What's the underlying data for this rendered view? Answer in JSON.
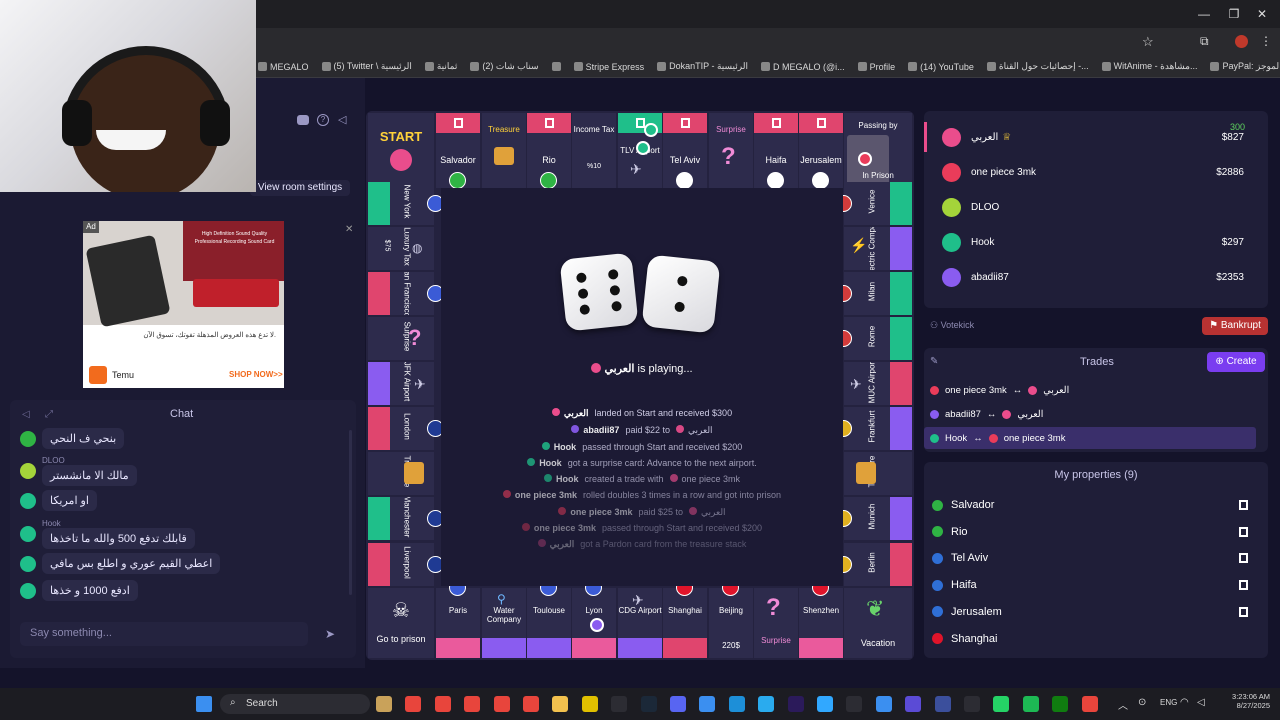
{
  "browser": {
    "bookmarks": [
      "MEGALO",
      "(5) Twitter \\ الرئيسية",
      "ثمانية",
      "(2) سناب شات",
      "",
      "Stripe Express",
      "DokanTIP - الرئيسية",
      "D MEGALO (@i...",
      "Profile",
      "(14) YouTube",
      "إحصائيات حول القناة -...",
      "WitAnime - مشاهدة...",
      "PayPal: الموجز"
    ]
  },
  "left": {
    "room_settings": "View room settings",
    "ad": {
      "badge": "Ad",
      "headline1": "High Definition Sound Quality",
      "headline2": "Professional Recording Sound Card",
      "text": "لا تدع هذه العروض المذهلة تفوتك، تسوق الآن.",
      "brand": "Temu",
      "cta": "SHOP NOW>>"
    },
    "chat": {
      "title": "Chat",
      "messages": [
        {
          "nick": "",
          "text": "بنحي ف النحي"
        },
        {
          "nick": "DLOO",
          "text": "مالك الا مانشستر"
        },
        {
          "nick": "",
          "text": "او امريكا"
        },
        {
          "nick": "Hook",
          "text": "قابلك تدفع 500 والله ما تاخذها"
        },
        {
          "nick": "",
          "text": "اعطي القيم عوري و اطلع بس مافي"
        },
        {
          "nick": "",
          "text": "ادفع 1000 و خذها"
        }
      ],
      "placeholder": "Say something..."
    }
  },
  "board": {
    "top": {
      "start": "START",
      "treasure": "Treasure",
      "income_tax": "Income Tax",
      "income_tax_pct": "%10",
      "surprise": "Surprise",
      "passing_by": "Passing by",
      "in_prison": "In Prison",
      "cities": [
        "Salvador",
        "Rio",
        "TLV Airport",
        "Tel Aviv",
        "Haifa",
        "Jerusalem"
      ]
    },
    "left": [
      "New York",
      "Luxury Tax",
      "$75",
      "San Francisco",
      "Surprise",
      "JFK Airport",
      "London",
      "Treasure",
      "Manchester",
      "Liverpool"
    ],
    "right": [
      "Venice",
      "Electric Company",
      "Milan",
      "Rome",
      "MUC Airport",
      "Frankfurt",
      "Treasure",
      "Munich",
      "Berlin"
    ],
    "bottom": {
      "go_to_prison": "Go to prison",
      "vacation": "Vacation",
      "surprise": "Surprise",
      "price": "220$",
      "cities": [
        "Paris",
        "Water Company",
        "Toulouse",
        "Lyon",
        "CDG Airport",
        "Shanghai",
        "Beijing",
        "Shenzhen"
      ]
    },
    "status": {
      "player": "العربي",
      "text": "is playing..."
    },
    "log": [
      {
        "a": "العربي",
        "t": "landed on Start and received $300"
      },
      {
        "a": "abadii87",
        "t": "paid $22 to",
        "b": "العربي"
      },
      {
        "a": "Hook",
        "t": "passed through Start and received $200"
      },
      {
        "a": "Hook",
        "t": "got a surprise card: Advance to the next airport."
      },
      {
        "a": "Hook",
        "t": "created a trade with",
        "b": "one piece 3mk"
      },
      {
        "a": "one piece 3mk",
        "t": "rolled doubles 3 times in a row and got into prison"
      },
      {
        "a": "one piece 3mk",
        "t": "paid $25 to",
        "b": "العربي"
      },
      {
        "a": "one piece 3mk",
        "t": "passed through Start and received $200"
      },
      {
        "a": "العربي",
        "t": "got a Pardon card from the treasure stack"
      }
    ]
  },
  "players": [
    {
      "name": "العربي",
      "crown": "♕",
      "money": "$827",
      "bonus": "300",
      "color": "#ea4d8c"
    },
    {
      "name": "one piece 3mk",
      "money": "$2886",
      "color": "#ea3c5a"
    },
    {
      "name": "DLOO",
      "money": "",
      "color": "#a4d43a"
    },
    {
      "name": "Hook",
      "money": "$297",
      "color": "#1fbf8a"
    },
    {
      "name": "abadii87",
      "money": "$2353",
      "color": "#8a5cf0"
    }
  ],
  "actions": {
    "votekick": "Votekick",
    "bankrupt": "Bankrupt"
  },
  "trades": {
    "title": "Trades",
    "create": "Create",
    "rows": [
      {
        "a": "one piece 3mk",
        "b": "العربي"
      },
      {
        "a": "abadii87",
        "b": "العربي"
      },
      {
        "a": "Hook",
        "b": "one piece 3mk"
      }
    ]
  },
  "properties": {
    "title": "My properties (9)",
    "items": [
      {
        "name": "Salvador",
        "color": "#2fb344"
      },
      {
        "name": "Rio",
        "color": "#2fb344"
      },
      {
        "name": "Tel Aviv",
        "color": "#2f6fd6"
      },
      {
        "name": "Haifa",
        "color": "#2f6fd6"
      },
      {
        "name": "Jerusalem",
        "color": "#2f6fd6"
      },
      {
        "name": "Shanghai",
        "color": "#e0142a"
      }
    ]
  },
  "taskbar": {
    "search": "Search",
    "lang": "ENG",
    "time": "3:23:06 AM",
    "date": "8/27/2025"
  }
}
